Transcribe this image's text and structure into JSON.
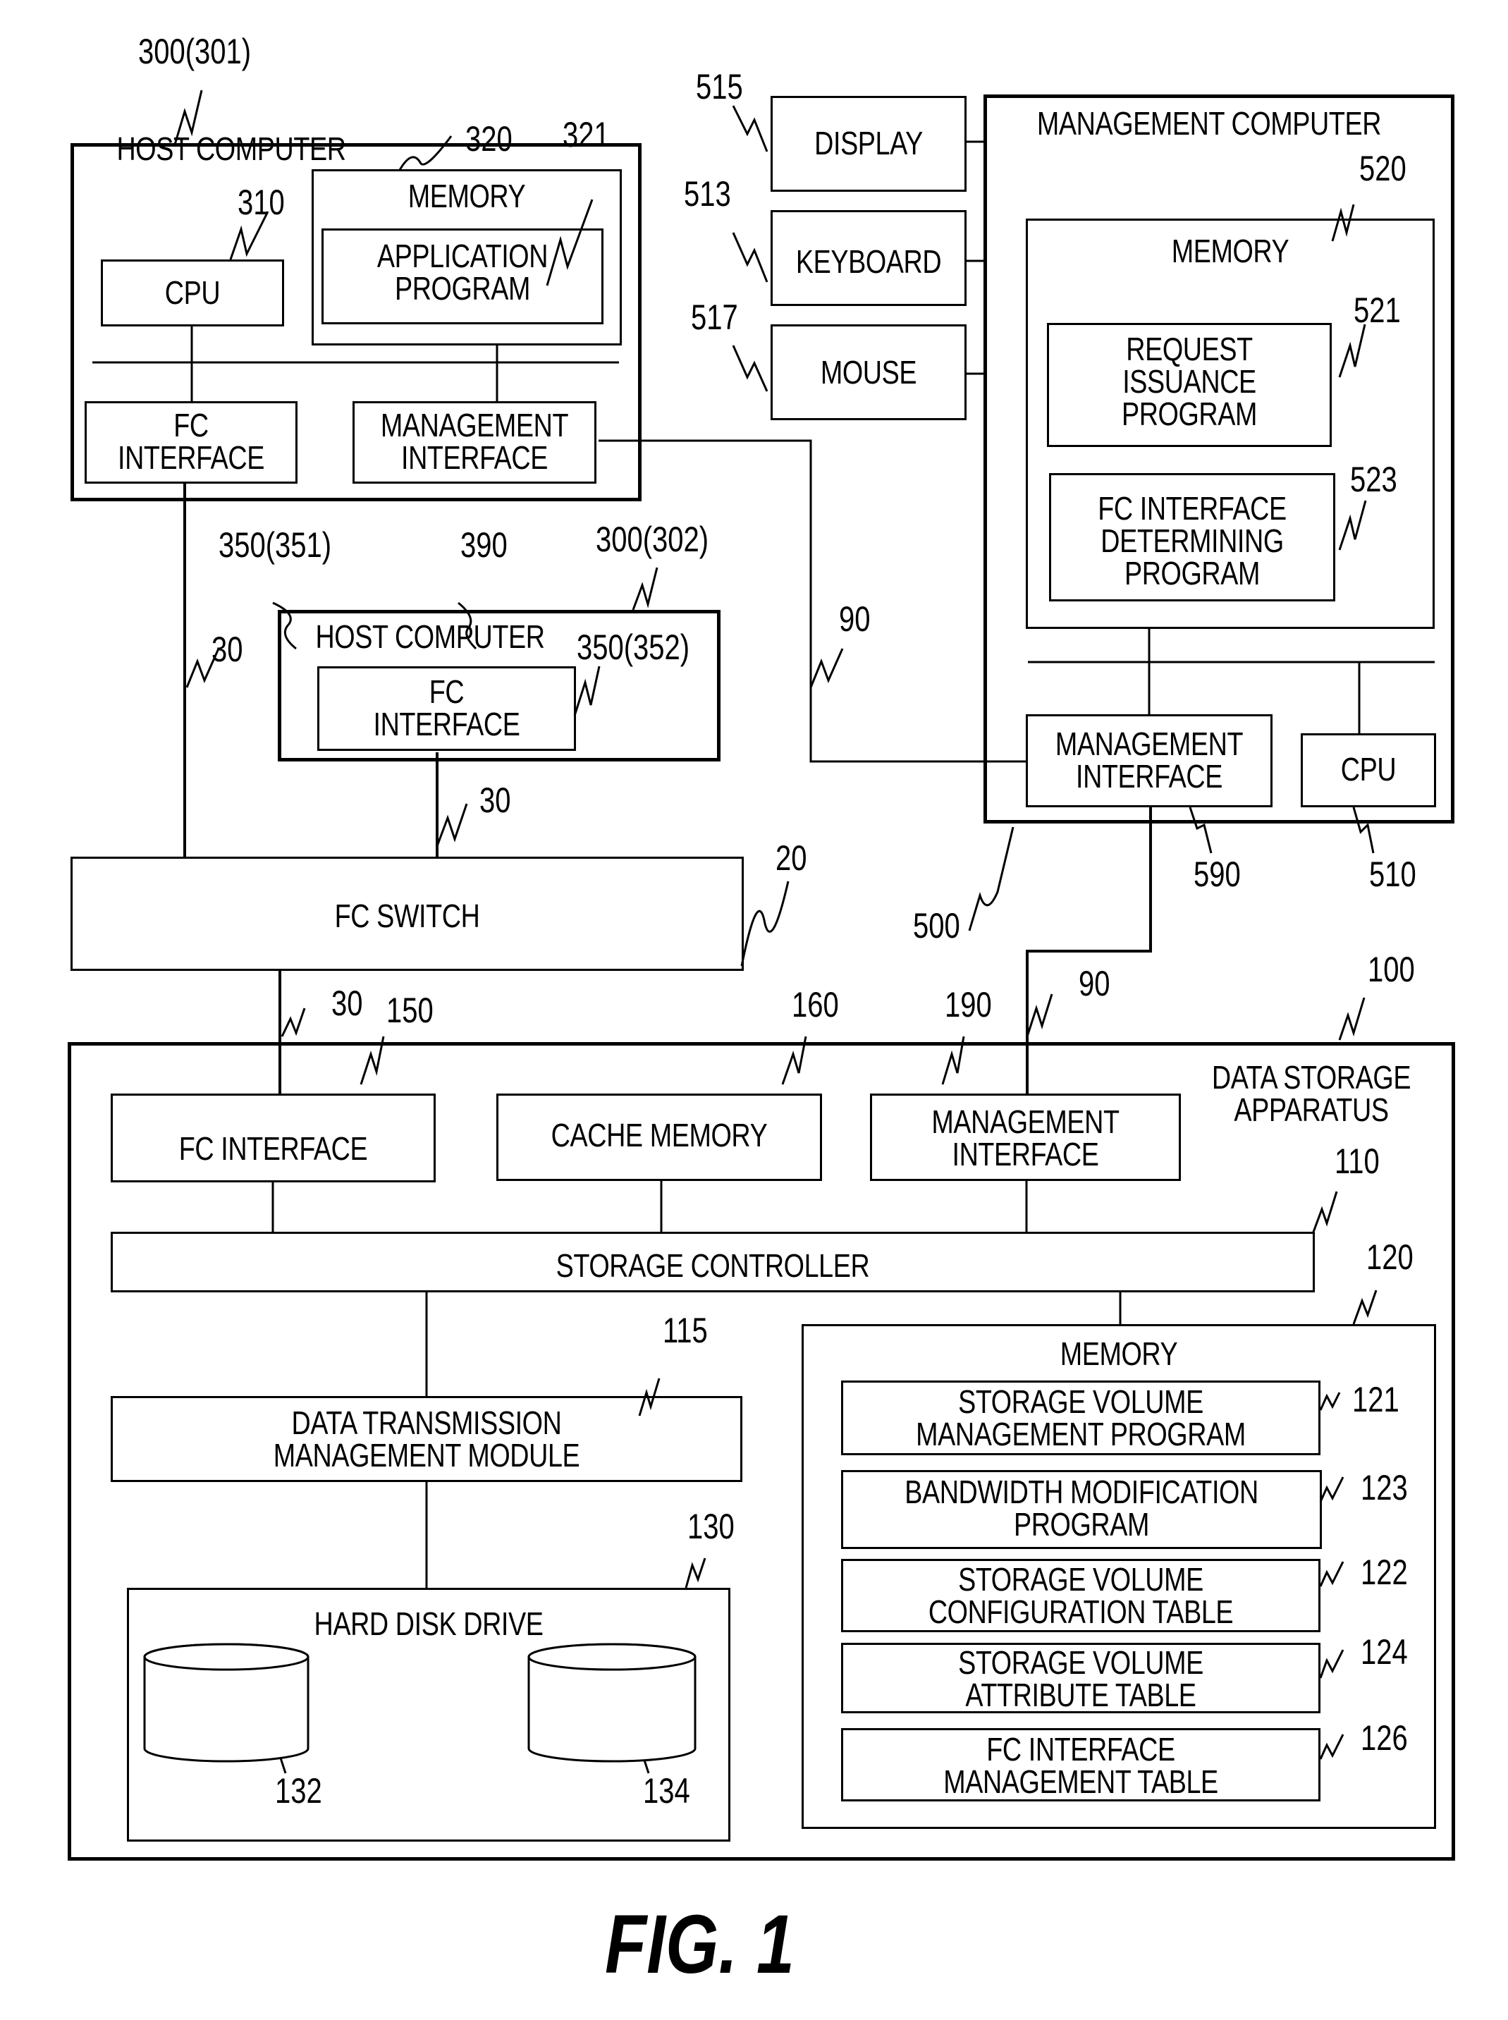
{
  "figure": {
    "caption": "FIG. 1"
  },
  "host_computer_1": {
    "title": "HOST COMPUTER",
    "ref": "300(301)",
    "cpu": {
      "label": "CPU",
      "ref": "310"
    },
    "memory": {
      "label": "MEMORY",
      "ref": "320",
      "application_program": {
        "label": "APPLICATION\nPROGRAM",
        "ref": "321"
      }
    },
    "fc_interface": {
      "label": "FC\nINTERFACE",
      "ref": "350(351)"
    },
    "management_interface": {
      "label": "MANAGEMENT\nINTERFACE",
      "ref": "390"
    }
  },
  "host_computer_2": {
    "title": "HOST COMPUTER",
    "ref": "300(302)",
    "fc_interface": {
      "label": "FC\nINTERFACE",
      "ref": "350(352)"
    }
  },
  "peripherals": {
    "display": {
      "label": "DISPLAY",
      "ref": "515"
    },
    "keyboard": {
      "label": "KEYBOARD",
      "ref": "513"
    },
    "mouse": {
      "label": "MOUSE",
      "ref": "517"
    }
  },
  "management_computer": {
    "title": "MANAGEMENT COMPUTER",
    "ref": "500",
    "memory": {
      "label": "MEMORY",
      "ref": "520",
      "request_issuance_program": {
        "label": "REQUEST\nISSUANCE\nPROGRAM",
        "ref": "521"
      },
      "fc_interface_determining_program": {
        "label": "FC INTERFACE\nDETERMINING\nPROGRAM",
        "ref": "523"
      }
    },
    "management_interface": {
      "label": "MANAGEMENT\nINTERFACE",
      "ref": "590"
    },
    "cpu": {
      "label": "CPU",
      "ref": "510"
    }
  },
  "fc_switch": {
    "label": "FC SWITCH",
    "ref": "20"
  },
  "links": {
    "fc_link_ref": "30",
    "mgmt_link_ref": "90"
  },
  "data_storage": {
    "title": "DATA STORAGE\nAPPARATUS",
    "ref": "100",
    "fc_interface": {
      "label": "FC INTERFACE",
      "ref": "150"
    },
    "cache_memory": {
      "label": "CACHE MEMORY",
      "ref": "160"
    },
    "management_interface": {
      "label": "MANAGEMENT\nINTERFACE",
      "ref": "190"
    },
    "storage_controller": {
      "label": "STORAGE CONTROLLER",
      "ref": "110"
    },
    "data_transmission_module": {
      "label": "DATA TRANSMISSION\nMANAGEMENT MODULE",
      "ref": "115"
    },
    "hard_disk_drive": {
      "label": "HARD DISK DRIVE",
      "ref": "130",
      "disk1_ref": "132",
      "disk2_ref": "134"
    },
    "memory": {
      "label": "MEMORY",
      "ref": "120",
      "items": [
        {
          "label": "STORAGE VOLUME\nMANAGEMENT PROGRAM",
          "ref": "121"
        },
        {
          "label": "BANDWIDTH MODIFICATION\nPROGRAM",
          "ref": "123"
        },
        {
          "label": "STORAGE VOLUME\nCONFIGURATION TABLE",
          "ref": "122"
        },
        {
          "label": "STORAGE VOLUME\nATTRIBUTE TABLE",
          "ref": "124"
        },
        {
          "label": "FC INTERFACE\nMANAGEMENT TABLE",
          "ref": "126"
        }
      ]
    }
  }
}
